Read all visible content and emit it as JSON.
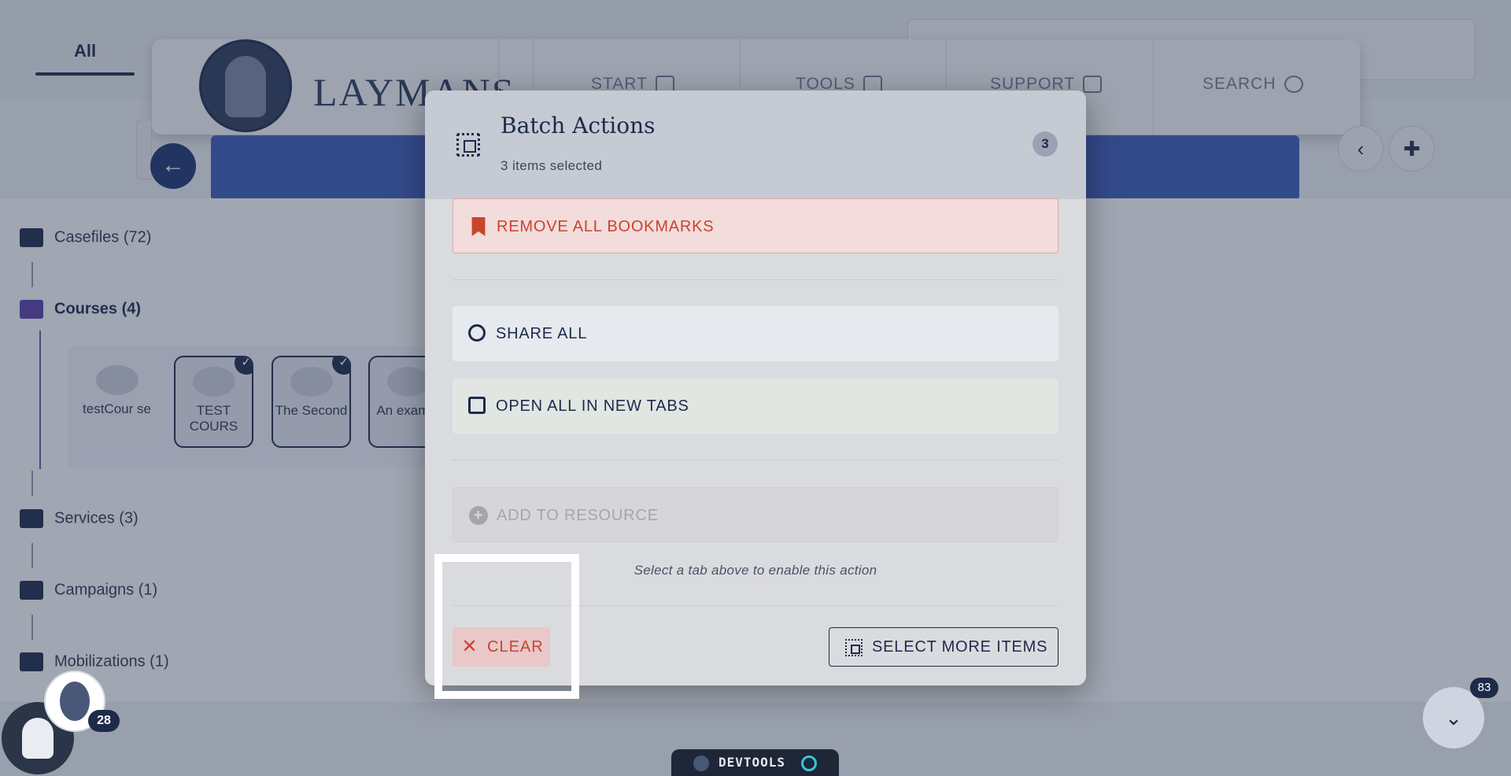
{
  "tabs": {
    "all_label": "All"
  },
  "header": {
    "logo_text": "LAYMANS",
    "nav": [
      {
        "label": "START",
        "icon": "ai-icon"
      },
      {
        "label": "TOOLS",
        "icon": "tools-icon"
      },
      {
        "label": "SUPPORT",
        "icon": "translate-icon"
      },
      {
        "label": "SEARCH",
        "icon": "search-icon"
      }
    ]
  },
  "sidebar": {
    "items": [
      {
        "label": "Casefiles (72)",
        "icon": "folder-icon"
      },
      {
        "label": "Courses (4)",
        "icon": "graduation-cap-icon",
        "active": true
      },
      {
        "label": "Services (3)",
        "icon": "briefcase-icon"
      },
      {
        "label": "Campaigns (1)",
        "icon": "megaphone-icon"
      },
      {
        "label": "Mobilizations (1)",
        "icon": "institution-icon"
      }
    ]
  },
  "courses": [
    {
      "label": "testCour se",
      "selected": false
    },
    {
      "label": "TEST COURS",
      "selected": true
    },
    {
      "label": "The Second",
      "selected": true
    },
    {
      "label": "An exampl",
      "selected": false
    }
  ],
  "check_mark": "✓",
  "modal": {
    "title": "Batch Actions",
    "subtitle": "3 items selected",
    "count": "3",
    "actions": {
      "remove_bookmarks": "REMOVE ALL BOOKMARKS",
      "share_all": "SHARE ALL",
      "open_all": "OPEN ALL IN NEW TABS",
      "add_to_resource": "ADD TO RESOURCE"
    },
    "hint": "Select a tab above to enable this action",
    "clear_label": "CLEAR",
    "select_more_label": "SELECT MORE ITEMS"
  },
  "widgets": {
    "avatar_badge": "28",
    "scroll_badge": "83",
    "devtools_label": "DEVTOOLS"
  },
  "colors": {
    "brand_navy": "#1d2a4a",
    "danger": "#c9442d",
    "hero_blue": "#3c5bb6",
    "active_purple": "#5b3ea8"
  }
}
